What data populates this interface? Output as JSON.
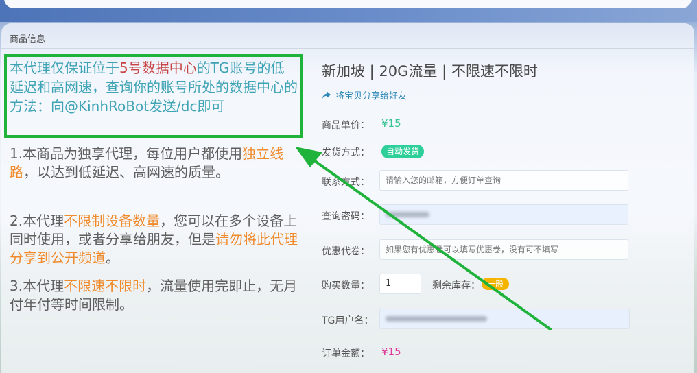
{
  "header": {
    "title": "商品信息"
  },
  "notice": {
    "part1": "本代理仅保证位于",
    "highlight": "5号数据中心",
    "part2": "的TG账号的低延迟和高网速，查询你的账号所处的数据中心的方法：向@KinhRoBot发送/dc即可"
  },
  "descriptions": [
    {
      "pre": "1.本商品为独享代理，每位用户都使用",
      "hl": "独立线路",
      "post": "，以达到低延迟、高网速的质量。"
    },
    {
      "pre": "2.本代理",
      "hl": "不限制设备数量",
      "mid": "，您可以在多个设备上同时使用，或者分享给朋友，但是",
      "hl2": "请勿将此代理分享到公开频道",
      "post": "。"
    },
    {
      "pre": "3.本代理",
      "hl": "不限速不限时",
      "post": "，流量使用完即止，无月付年付等时间限制。"
    }
  ],
  "product": {
    "title": "新加坡 | 20G流量 | 不限速不限时",
    "share_label": "将宝贝分享给好友",
    "price_label": "商品单价：",
    "price": "¥15",
    "delivery_label": "发货方式：",
    "delivery_value": "自动发货",
    "contact_label": "联系方式：",
    "contact_placeholder": "请输入您的邮箱，方便订单查询",
    "password_label": "查询密码：",
    "coupon_label": "优惠代卷：",
    "coupon_placeholder": "如果您有优惠卷可以填写优惠卷，没有可不填写",
    "qty_label": "购买数量：",
    "qty_value": "1",
    "stock_label": "剩余库存：",
    "stock_value": "一般",
    "tg_label": "TG用户名：",
    "total_label": "订单金额：",
    "total_value": "¥15"
  },
  "colors": {
    "notice_border": "#1fb33b",
    "notice_text": "#3ea3b4",
    "highlight_red": "#c74242",
    "highlight_orange": "#f08a2b",
    "price": "#34c48f",
    "total": "#e0389a",
    "badge_auto": "#2fcf99",
    "badge_stock": "#f4b400"
  }
}
